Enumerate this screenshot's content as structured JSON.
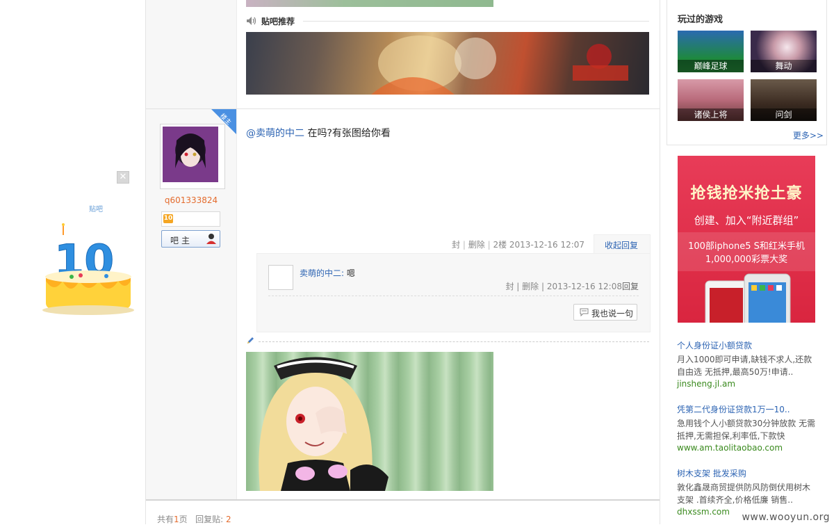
{
  "thread": {
    "recommend_title": "贴吧推荐",
    "post": {
      "username": "q601333824",
      "badge_text": "楼主",
      "level_num": "10",
      "role_label": "吧主",
      "at_user": "@卖萌的中二",
      "text": " 在吗?有张图给你看",
      "meta": {
        "block": "封",
        "delete": "删除",
        "floor": "2楼",
        "time": "2013-12-16 12:07",
        "sep": "|"
      },
      "collapse_reply": "收起回复"
    },
    "lzl_reply": {
      "name": "卖萌的中二:",
      "text": " 嗯",
      "block": "封",
      "delete": "删除",
      "time": "2013-12-16 12:08",
      "reply": "回复",
      "say_button": "我也说一句"
    },
    "pager": {
      "total_prefix": "共有",
      "pages": "1",
      "pages_suffix": "页",
      "replies_prefix": "回复贴:",
      "replies": "2"
    }
  },
  "float_ad": {
    "close_icon": "close-icon",
    "caption": "贴吧",
    "number": "10"
  },
  "sidebar": {
    "games_title": "玩过的游戏",
    "games": [
      {
        "name": "巅峰足球"
      },
      {
        "name": "舞动"
      },
      {
        "name": "诸侯上将"
      },
      {
        "name": "问剑"
      }
    ],
    "more": "更多>>",
    "red_ad": {
      "headline": "抢钱抢米抢土豪",
      "subline": "创建、加入“附近群组”",
      "line1": "100部iphone5 S和红米手机",
      "line2": "1,000,000彩票大奖"
    },
    "text_ads": [
      {
        "title": "个人身份证小额贷款",
        "desc": "月入1000即可申请,缺钱不求人,还款自由选 无抵押,最高50万!申请..",
        "url": "jinsheng.jl.am"
      },
      {
        "title": "凭第二代身份证贷款1万一10..",
        "desc": "急用钱个人小额贷款30分钟放款 无需抵押,无需担保,利率低,下款快",
        "url": "www.am.taolitaobao.com"
      },
      {
        "title": "树木支架 批发采购",
        "desc": "敦化鑫晟商贸提供防风防倒伏用树木支架 .首续齐全,价格低廉 销售..",
        "url": "dhxssm.com"
      }
    ]
  },
  "watermark": "www.wooyun.org",
  "colors": {
    "link": "#2d64b3",
    "username": "#e46b2d",
    "ad_url": "#3a8a1e",
    "ad_red": "#d9253f"
  }
}
